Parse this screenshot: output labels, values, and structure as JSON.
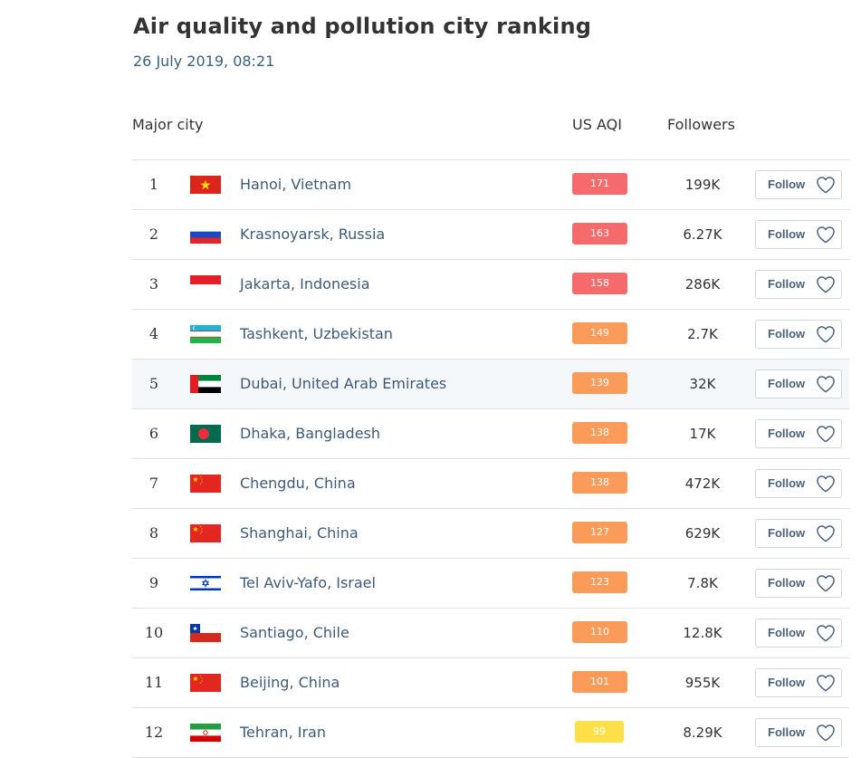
{
  "title": "Air quality and pollution city ranking",
  "date": "26 July 2019, 08:21",
  "columns": {
    "city": "Major city",
    "aqi": "US AQI",
    "followers": "Followers"
  },
  "follow_label": "Follow",
  "aqi_colors": {
    "unhealthy": "#f56b6b",
    "sensitive": "#fb9b5a",
    "moderate": "#fde047"
  },
  "rows": [
    {
      "rank": "1",
      "city": "Hanoi, Vietnam",
      "aqi": "171",
      "level": "unhealthy",
      "followers": "199K",
      "flag": "vietnam-flag-icon"
    },
    {
      "rank": "2",
      "city": "Krasnoyarsk, Russia",
      "aqi": "163",
      "level": "unhealthy",
      "followers": "6.27K",
      "flag": "russia-flag-icon"
    },
    {
      "rank": "3",
      "city": "Jakarta, Indonesia",
      "aqi": "158",
      "level": "unhealthy",
      "followers": "286K",
      "flag": "indonesia-flag-icon"
    },
    {
      "rank": "4",
      "city": "Tashkent, Uzbekistan",
      "aqi": "149",
      "level": "sensitive",
      "followers": "2.7K",
      "flag": "uzbekistan-flag-icon"
    },
    {
      "rank": "5",
      "city": "Dubai, United Arab Emirates",
      "aqi": "139",
      "level": "sensitive",
      "followers": "32K",
      "flag": "uae-flag-icon"
    },
    {
      "rank": "6",
      "city": "Dhaka, Bangladesh",
      "aqi": "138",
      "level": "sensitive",
      "followers": "17K",
      "flag": "bangladesh-flag-icon"
    },
    {
      "rank": "7",
      "city": "Chengdu, China",
      "aqi": "138",
      "level": "sensitive",
      "followers": "472K",
      "flag": "china-flag-icon"
    },
    {
      "rank": "8",
      "city": "Shanghai, China",
      "aqi": "127",
      "level": "sensitive",
      "followers": "629K",
      "flag": "china-flag-icon"
    },
    {
      "rank": "9",
      "city": "Tel Aviv-Yafo, Israel",
      "aqi": "123",
      "level": "sensitive",
      "followers": "7.8K",
      "flag": "israel-flag-icon"
    },
    {
      "rank": "10",
      "city": "Santiago, Chile",
      "aqi": "110",
      "level": "sensitive",
      "followers": "12.8K",
      "flag": "chile-flag-icon"
    },
    {
      "rank": "11",
      "city": "Beijing, China",
      "aqi": "101",
      "level": "sensitive",
      "followers": "955K",
      "flag": "china-flag-icon"
    },
    {
      "rank": "12",
      "city": "Tehran, Iran",
      "aqi": "99",
      "level": "moderate",
      "followers": "8.29K",
      "flag": "iran-flag-icon"
    }
  ]
}
